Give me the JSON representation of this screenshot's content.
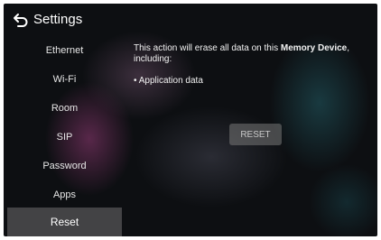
{
  "header": {
    "title": "Settings",
    "back_icon": "back-arrow-icon"
  },
  "sidebar": {
    "items": [
      {
        "label": "Ethernet",
        "active": false
      },
      {
        "label": "Wi-Fi",
        "active": false
      },
      {
        "label": "Room",
        "active": false
      },
      {
        "label": "SIP",
        "active": false
      },
      {
        "label": "Password",
        "active": false
      },
      {
        "label": "Apps",
        "active": false
      },
      {
        "label": "Reset",
        "active": true
      }
    ]
  },
  "main": {
    "message_prefix": "This action will erase all data on this ",
    "message_bold": "Memory Device",
    "message_suffix": ", including:",
    "bullet": "• Application data",
    "reset_button": "RESET"
  },
  "colors": {
    "background": "#0d0f12",
    "active_item": "#48484a",
    "button": "#787878"
  }
}
